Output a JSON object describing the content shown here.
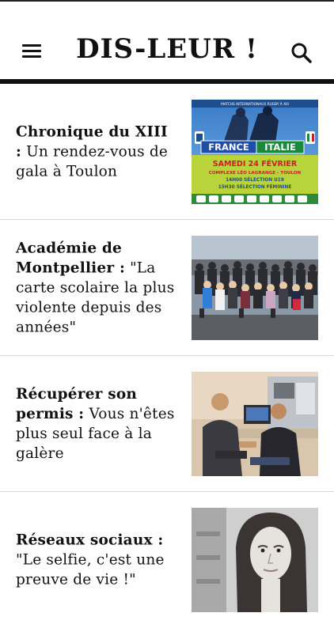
{
  "header": {
    "brand": "DIS-LEUR !"
  },
  "articles": [
    {
      "kicker": "Chronique du XIII :",
      "title": "Un rendez-vous de gala à Toulon",
      "thumb": {
        "top_banner": "MATCHS INTERNATIONAUX RUGBY À XIII",
        "team_left": "FRANCE",
        "team_right": "ITALIE",
        "date": "SAMEDI 24 FÉVRIER",
        "venue": "COMPLEXE LÉO LAGRANGE - TOULON",
        "line1": "14H00 SÉLECTION U19",
        "line2": "15H30 SÉLECTION FÉMININE"
      }
    },
    {
      "kicker": "Académie de Montpellier :",
      "title": "\"La carte scolaire la plus violente depuis des années\""
    },
    {
      "kicker": "Récupérer son permis :",
      "title": "Vous n'êtes plus seul face à la galère"
    },
    {
      "kicker": "Réseaux sociaux :",
      "title": "\"Le selfie, c'est une preuve de vie !\""
    }
  ]
}
